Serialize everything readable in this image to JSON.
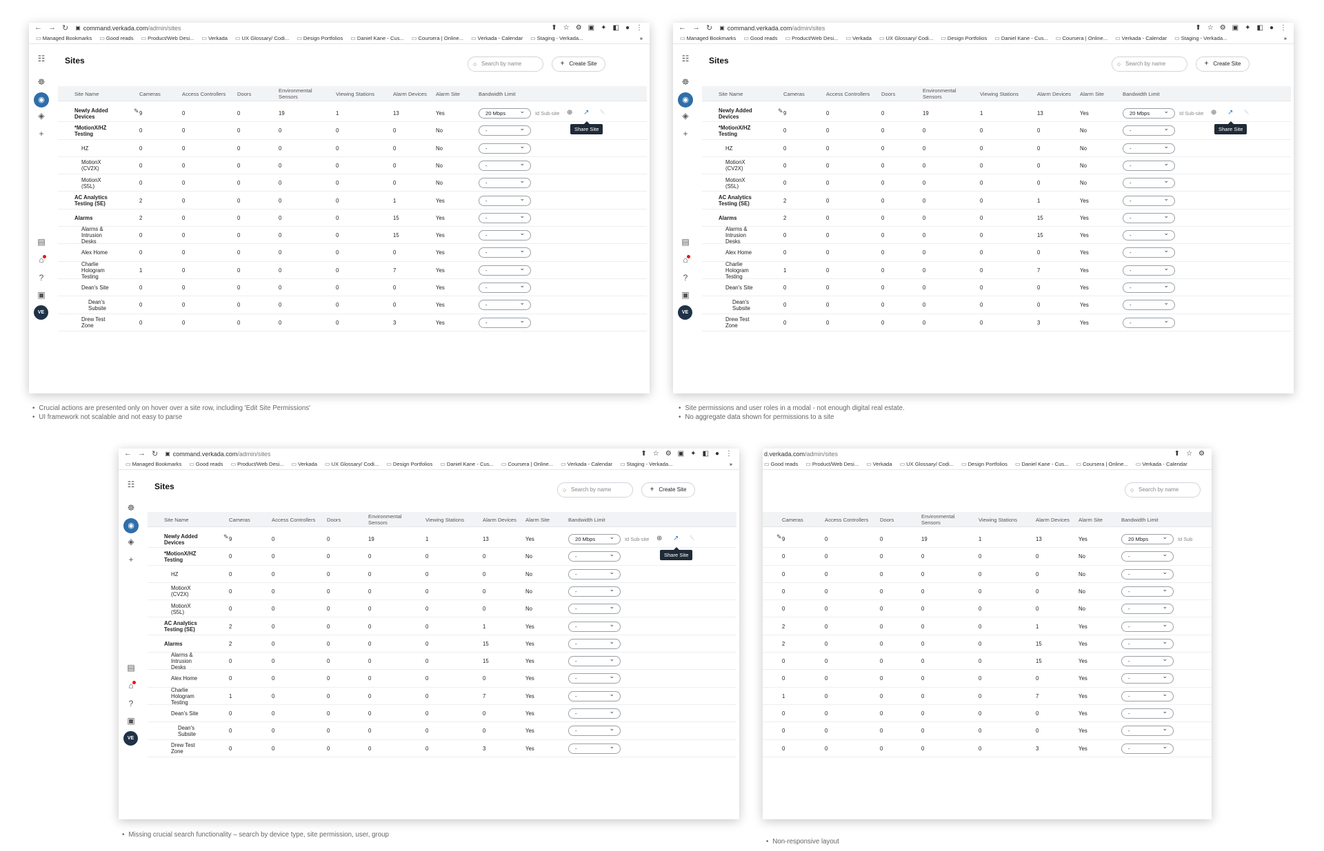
{
  "browser": {
    "url_host": "command.verkada.com",
    "url_path": "/admin/sites",
    "url_host_cropped": "d.verkada.com",
    "bookmarks": [
      "Managed Bookmarks",
      "Good reads",
      "Product/Web Desi...",
      "Verkada",
      "UX Glossary/ Codi...",
      "Design Portfolios",
      "Daniel Kane - Cus...",
      "Coursera | Online...",
      "Verkada - Calendar",
      "Staging - Verkada..."
    ],
    "bookmarks_cropped": [
      "Good reads",
      "Product/Web Desi...",
      "Verkada",
      "UX Glossary/ Codi...",
      "Design Portfolios",
      "Daniel Kane - Cus...",
      "Coursera | Online...",
      "Verkada - Calendar"
    ],
    "more": "»"
  },
  "page": {
    "title": "Sites",
    "search_placeholder": "Search by name",
    "create_button": "Create Site",
    "avatar": "VE",
    "tooltip": "Share Site",
    "add_subsite": "Id Sub-site",
    "add_subsite_cropped": "Id Sub"
  },
  "columns": [
    "Site Name",
    "Cameras",
    "Access Controllers",
    "Doors",
    "Environmental Sensors",
    "Viewing Stations",
    "Alarm Devices",
    "Alarm Site",
    "Bandwidth Limit"
  ],
  "rows": [
    {
      "name": "Newly Added Devices",
      "level": 0,
      "cameras": "9",
      "access": "0",
      "doors": "0",
      "env": "19",
      "viewing": "1",
      "alarm": "13",
      "alarm_site": "Yes",
      "bandwidth": "20 Mbps"
    },
    {
      "name": "*MotionX/HZ Testing",
      "level": 0,
      "cameras": "0",
      "access": "0",
      "doors": "0",
      "env": "0",
      "viewing": "0",
      "alarm": "0",
      "alarm_site": "No",
      "bandwidth": "-"
    },
    {
      "name": "HZ",
      "level": 1,
      "cameras": "0",
      "access": "0",
      "doors": "0",
      "env": "0",
      "viewing": "0",
      "alarm": "0",
      "alarm_site": "No",
      "bandwidth": "-"
    },
    {
      "name": "MotionX (CV2X)",
      "level": 1,
      "cameras": "0",
      "access": "0",
      "doors": "0",
      "env": "0",
      "viewing": "0",
      "alarm": "0",
      "alarm_site": "No",
      "bandwidth": "-"
    },
    {
      "name": "MotionX (S5L)",
      "level": 1,
      "cameras": "0",
      "access": "0",
      "doors": "0",
      "env": "0",
      "viewing": "0",
      "alarm": "0",
      "alarm_site": "No",
      "bandwidth": "-"
    },
    {
      "name": "AC Analytics Testing (SE)",
      "level": 0,
      "cameras": "2",
      "access": "0",
      "doors": "0",
      "env": "0",
      "viewing": "0",
      "alarm": "1",
      "alarm_site": "Yes",
      "bandwidth": "-"
    },
    {
      "name": "Alarms",
      "level": 0,
      "cameras": "2",
      "access": "0",
      "doors": "0",
      "env": "0",
      "viewing": "0",
      "alarm": "15",
      "alarm_site": "Yes",
      "bandwidth": "-"
    },
    {
      "name": "Alarms & Intrusion Desks",
      "level": 1,
      "cameras": "0",
      "access": "0",
      "doors": "0",
      "env": "0",
      "viewing": "0",
      "alarm": "15",
      "alarm_site": "Yes",
      "bandwidth": "-"
    },
    {
      "name": "Alex Home",
      "level": 1,
      "cameras": "0",
      "access": "0",
      "doors": "0",
      "env": "0",
      "viewing": "0",
      "alarm": "0",
      "alarm_site": "Yes",
      "bandwidth": "-"
    },
    {
      "name": "Charlie Hologram Testing",
      "level": 1,
      "cameras": "1",
      "access": "0",
      "doors": "0",
      "env": "0",
      "viewing": "0",
      "alarm": "7",
      "alarm_site": "Yes",
      "bandwidth": "-"
    },
    {
      "name": "Dean's Site",
      "level": 1,
      "cameras": "0",
      "access": "0",
      "doors": "0",
      "env": "0",
      "viewing": "0",
      "alarm": "0",
      "alarm_site": "Yes",
      "bandwidth": "-"
    },
    {
      "name": "Dean's Subsite",
      "level": 2,
      "cameras": "0",
      "access": "0",
      "doors": "0",
      "env": "0",
      "viewing": "0",
      "alarm": "0",
      "alarm_site": "Yes",
      "bandwidth": "-"
    },
    {
      "name": "Drew Test Zone",
      "level": 1,
      "cameras": "0",
      "access": "0",
      "doors": "0",
      "env": "0",
      "viewing": "0",
      "alarm": "3",
      "alarm_site": "Yes",
      "bandwidth": "-"
    }
  ],
  "notes": {
    "panel1": [
      "Crucial actions are presented only on hover over a site row, including 'Edit Site Permissions'",
      "UI framework not scalable and not easy to parse"
    ],
    "panel2": [
      "Site permissions and user roles in a modal - not enough digital real estate.",
      "No aggregate data shown for permissions to a site"
    ],
    "panel3": [
      "Missing crucial search functionality – search by device type, site permission, user, group"
    ],
    "panel4": [
      "Non-responsive layout"
    ]
  },
  "icons": {
    "rail": [
      "apps-grid-icon",
      "sites-org-icon",
      "location-pin-icon",
      "layers-icon",
      "plus-icon",
      "document-icon",
      "bell-icon",
      "help-icon",
      "briefcase-icon",
      "avatar"
    ],
    "row_actions": [
      "add-subsite-icon",
      "share-site-icon",
      "trash-icon"
    ]
  },
  "colors": {
    "accent": "#2f6ea9",
    "share": "#2f78c4",
    "tooltip": "#1f2a37",
    "notification": "#e11111"
  }
}
